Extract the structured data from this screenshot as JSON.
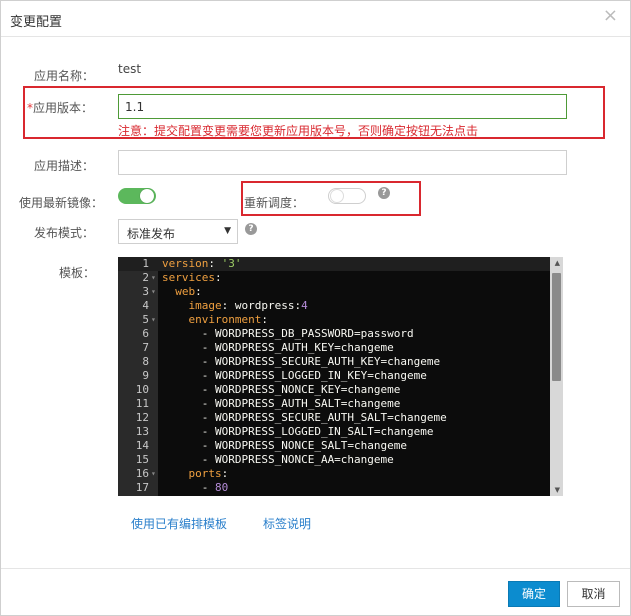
{
  "dialog": {
    "title": "变更配置",
    "close_icon": "×"
  },
  "form": {
    "app_name": {
      "label": "应用名称：",
      "value": "test"
    },
    "app_version": {
      "required_mark": "*",
      "label": "应用版本：",
      "value": "1.1",
      "warning": "注意：提交配置变更需要您更新应用版本号，否则确定按钮无法点击"
    },
    "app_desc": {
      "label": "应用描述：",
      "value": ""
    },
    "latest_image": {
      "label": "使用最新镜像：",
      "state": "on"
    },
    "reschedule": {
      "label": "重新调度：",
      "state": "off",
      "help": "?"
    },
    "release_mode": {
      "label": "发布模式：",
      "selected": "标准发布",
      "caret": "▼",
      "help": "?"
    },
    "template": {
      "label": "模板："
    }
  },
  "editor": {
    "lines": [
      {
        "n": "1",
        "fold": "",
        "html": "<span class=\"k\">version</span>: <span class=\"s\">'3'</span>"
      },
      {
        "n": "2",
        "fold": "▾",
        "html": "<span class=\"k\">services</span>:"
      },
      {
        "n": "3",
        "fold": "▾",
        "html": "  <span class=\"k\">web</span>:"
      },
      {
        "n": "4",
        "fold": "",
        "html": "    <span class=\"k\">image</span>: wordpress:<span class=\"n\">4</span>"
      },
      {
        "n": "5",
        "fold": "▾",
        "html": "    <span class=\"k\">environment</span>:"
      },
      {
        "n": "6",
        "fold": "",
        "html": "      - WORDPRESS_DB_PASSWORD=password"
      },
      {
        "n": "7",
        "fold": "",
        "html": "      - WORDPRESS_AUTH_KEY=changeme"
      },
      {
        "n": "8",
        "fold": "",
        "html": "      - WORDPRESS_SECURE_AUTH_KEY=changeme"
      },
      {
        "n": "9",
        "fold": "",
        "html": "      - WORDPRESS_LOGGED_IN_KEY=changeme"
      },
      {
        "n": "10",
        "fold": "",
        "html": "      - WORDPRESS_NONCE_KEY=changeme"
      },
      {
        "n": "11",
        "fold": "",
        "html": "      - WORDPRESS_AUTH_SALT=changeme"
      },
      {
        "n": "12",
        "fold": "",
        "html": "      - WORDPRESS_SECURE_AUTH_SALT=changeme"
      },
      {
        "n": "13",
        "fold": "",
        "html": "      - WORDPRESS_LOGGED_IN_SALT=changeme"
      },
      {
        "n": "14",
        "fold": "",
        "html": "      - WORDPRESS_NONCE_SALT=changeme"
      },
      {
        "n": "15",
        "fold": "",
        "html": "      - WORDPRESS_NONCE_AA=changeme"
      },
      {
        "n": "16",
        "fold": "▾",
        "html": "    <span class=\"k\">ports</span>:"
      },
      {
        "n": "17",
        "fold": "",
        "html": "      - <span class=\"n\">80</span>"
      }
    ]
  },
  "links": {
    "use_template": "使用已有编排模板",
    "label_help": "标签说明"
  },
  "buttons": {
    "confirm": "确定",
    "cancel": "取消"
  },
  "colors": {
    "highlight_border": "#d9282f",
    "toggle_on": "#5cb85c",
    "primary_button": "#0c8ccf",
    "link": "#2a7fcb"
  }
}
